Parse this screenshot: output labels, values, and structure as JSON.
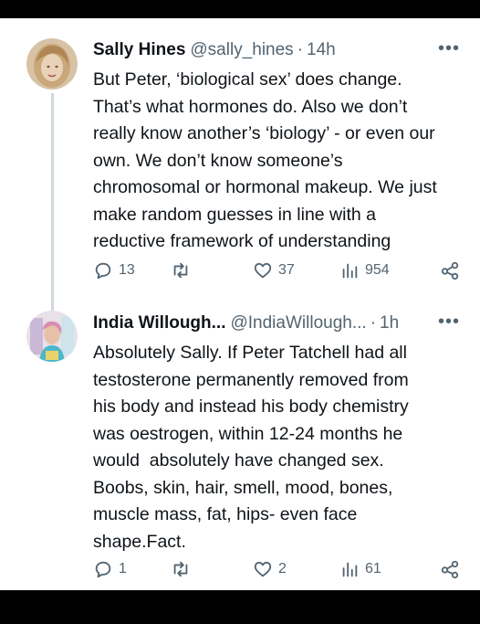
{
  "tweets": [
    {
      "avatar_colors": [
        "#c9a77a",
        "#e8d3b8",
        "#7a5a3a"
      ],
      "name": "Sally Hines",
      "handle": "@sally_hines",
      "separator": "·",
      "time": "14h",
      "more_icon": "more-horizontal-icon",
      "text": "But Peter, ‘biological sex’ does change.\nThat’s what hormones do. Also we don’t\nreally know another’s ‘biology’ - or even our\nown. We don’t know someone’s\nchromosomal or hormonal makeup. We just\nmake random guesses in line with a\nreductive framework of understanding",
      "actions": {
        "replies": "13",
        "retweets": "",
        "likes": "37",
        "views": "954"
      }
    },
    {
      "avatar_colors": [
        "#e8e1e8",
        "#d98bb5",
        "#4fb6c9"
      ],
      "name": "India Willough...",
      "handle": "@IndiaWillough...",
      "separator": "·",
      "time": "1h",
      "more_icon": "more-horizontal-icon",
      "text": "Absolutely Sally. If Peter Tatchell had all\ntestosterone permanently removed from\nhis body and instead his body chemistry\nwas oestrogen, within 12-24 months he\nwould  absolutely have changed sex.\nBoobs, skin, hair, smell, mood, bones,\nmuscle mass, fat, hips- even face\nshape.Fact.",
      "actions": {
        "replies": "1",
        "retweets": "",
        "likes": "2",
        "views": "61"
      }
    }
  ],
  "colors": {
    "text": "#0f1419",
    "secondary": "#536471",
    "thread_line": "#cfd9de"
  }
}
